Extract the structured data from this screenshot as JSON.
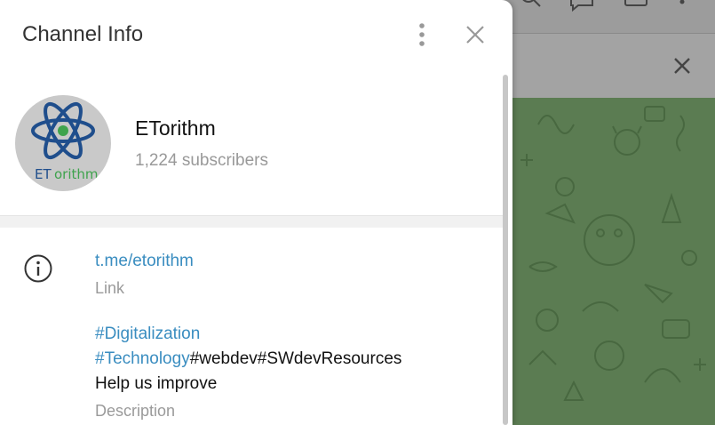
{
  "panel": {
    "title": "Channel Info"
  },
  "channel": {
    "name": "ETorithm",
    "subscribers": "1,224 subscribers",
    "avatar_logo_text": "ETorithm"
  },
  "info": {
    "link": "t.me/etorithm",
    "link_label": "Link",
    "description": {
      "line1_tag": "#Digitalization",
      "line2_tag": "#Technology",
      "line2_text": "#webdev#SWdevResources",
      "line3": "Help us improve"
    },
    "description_label": "Description"
  },
  "icons": {
    "menu": "more-vertical-icon",
    "close": "close-icon",
    "info": "info-circle-icon",
    "header_search": "search-icon",
    "header_comments": "comments-icon",
    "header_sidebar": "sidebar-icon",
    "header_more": "more-vertical-icon"
  },
  "colors": {
    "accent": "#3a8dc0",
    "chat_background": "#5b7c52",
    "avatar_blue": "#1f4e8c",
    "avatar_green": "#3fa34d"
  }
}
